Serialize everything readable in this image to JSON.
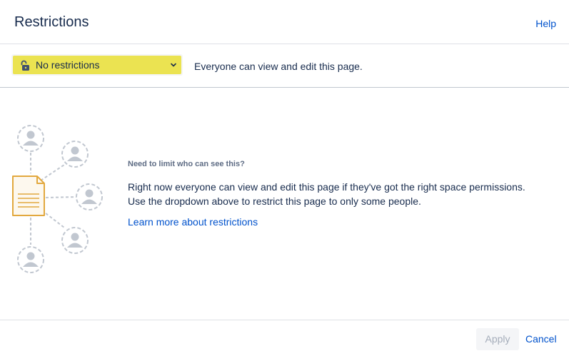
{
  "header": {
    "title": "Restrictions",
    "help_label": "Help"
  },
  "restriction_select": {
    "selected": "No restrictions",
    "icon": "unlock-icon",
    "highlight_color": "#ebe351"
  },
  "status_text": "Everyone can view and edit this page.",
  "info": {
    "heading": "Need to limit who can see this?",
    "line1": "Right now everyone can view and edit this page if they've got the right space permissions.",
    "line2": "Use the dropdown above to restrict this page to only some people.",
    "learn_more": "Learn more about restrictions"
  },
  "footer": {
    "apply_label": "Apply",
    "cancel_label": "Cancel"
  },
  "colors": {
    "link": "#0052cc",
    "text": "#172b4d",
    "muted": "#5e6c84",
    "disabled_text": "#a5adba",
    "illustration_accent": "#e2a83e"
  }
}
